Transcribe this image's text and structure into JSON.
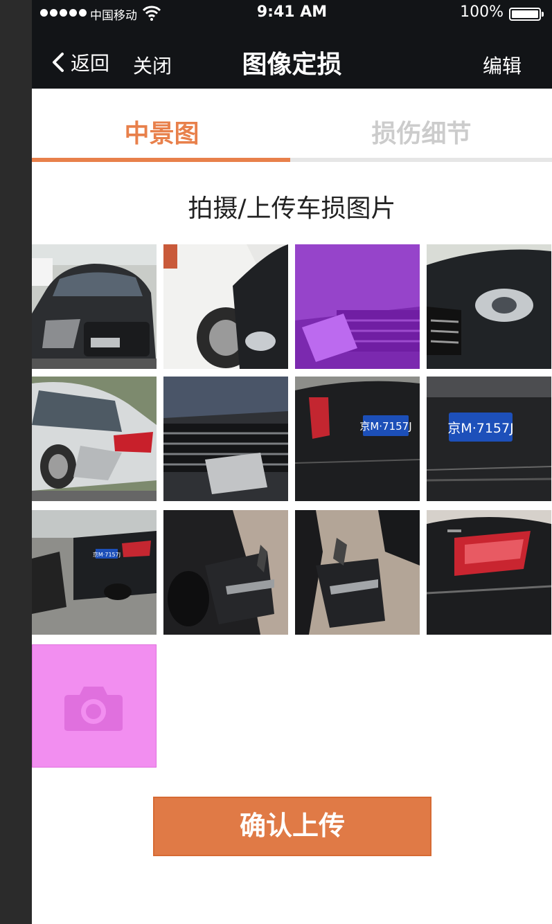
{
  "status_bar": {
    "carrier": "中国移动",
    "time": "9:41 AM",
    "battery": "100%"
  },
  "nav": {
    "back_label": "返回",
    "close_label": "关闭",
    "title": "图像定损",
    "edit_label": "编辑"
  },
  "tabs": [
    {
      "label": "中景图",
      "active": true
    },
    {
      "label": "损伤细节",
      "active": false
    }
  ],
  "section_title": "拍摄/上传车损图片",
  "photos": [
    {
      "icon": "car-photo-front-damage",
      "selected": false
    },
    {
      "icon": "car-photo-side-headlight",
      "selected": false
    },
    {
      "icon": "car-photo-grille-damage",
      "selected": true
    },
    {
      "icon": "car-photo-headlight-closeup",
      "selected": false
    },
    {
      "icon": "car-photo-rear-white-damage",
      "selected": false
    },
    {
      "icon": "car-photo-grille-closeup",
      "selected": false
    },
    {
      "icon": "car-photo-rear-plate",
      "selected": false
    },
    {
      "icon": "car-photo-rear-plate-closeup",
      "selected": false
    },
    {
      "icon": "car-photo-rear-street",
      "selected": false
    },
    {
      "icon": "car-photo-bumper-damage",
      "selected": false
    },
    {
      "icon": "car-photo-bumper-closeup",
      "selected": false
    },
    {
      "icon": "car-photo-taillight",
      "selected": false
    }
  ],
  "plates": [
    "京M·7157J",
    "京M·7157J",
    "京M·7157J"
  ],
  "upload": {
    "icon": "camera-icon"
  },
  "confirm_label": "确认上传",
  "colors": {
    "accent": "#e8804b",
    "button": "#e07a46",
    "topbar": "#121417",
    "upload_tile": "#f28ef0",
    "selected_overlay": "#aa1eff",
    "inactive_tab": "#cccccc"
  }
}
